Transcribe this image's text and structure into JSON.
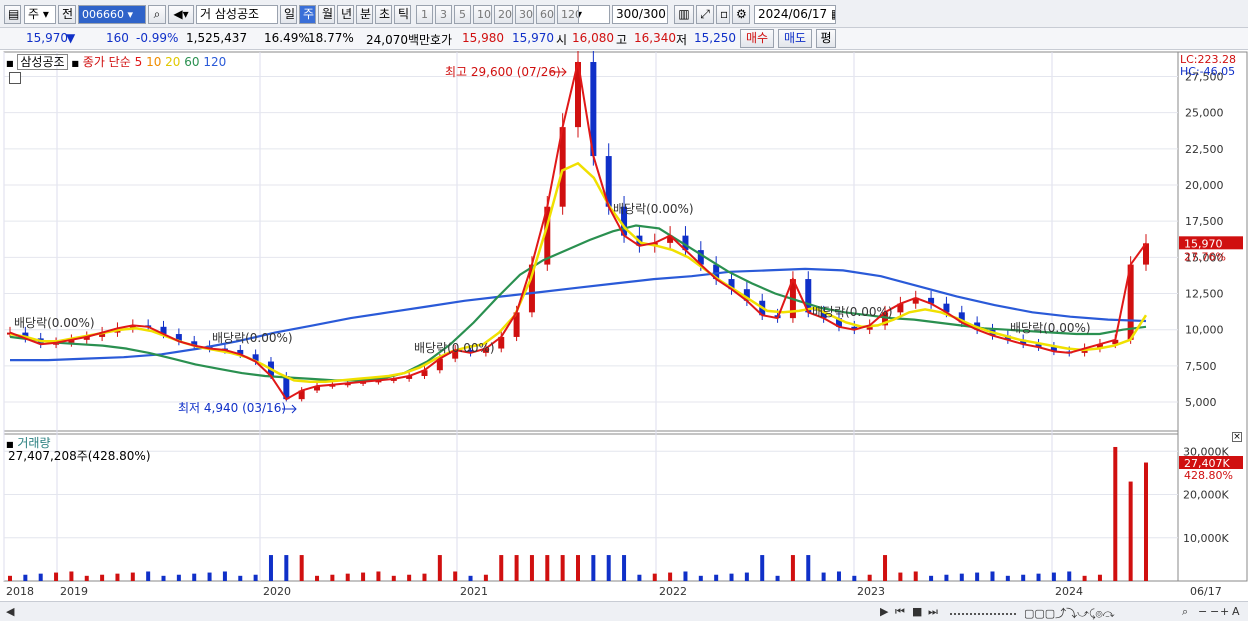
{
  "toolbar": {
    "period_label": "주",
    "prev_label": "전",
    "code": "006660",
    "name_prefix": "거",
    "name": "삼성공조",
    "tabs": [
      "일",
      "주",
      "월",
      "년",
      "분",
      "초",
      "틱"
    ],
    "active_tab": "주",
    "nums": [
      "1",
      "3",
      "5",
      "10",
      "20",
      "30",
      "60",
      "120"
    ],
    "count": "300/300",
    "date": "2024/06/17"
  },
  "quote": {
    "price": "15,970",
    "arrow": "▼",
    "change": "160",
    "rate": "-0.99%",
    "volume": "1,525,437",
    "ratio1": "16.49%",
    "ratio2": "18.77%",
    "amount": "24,070백만",
    "bid_label": "호가",
    "ask": "15,980",
    "bid": "15,970",
    "open_label": "시",
    "open": "16,080",
    "high_label": "고",
    "high": "16,340",
    "low_label": "저",
    "low": "15,250",
    "buy_label": "매수",
    "sell_label": "매도",
    "eval_label": "평"
  },
  "legend": {
    "name": "삼성공조",
    "price_label": "종가 단순",
    "ma": [
      "5",
      "10",
      "20",
      "60",
      "120"
    ],
    "volume_title": "거래량",
    "volume_value": "27,407,208주(428.80%)"
  },
  "colors": {
    "ma5": "#e01818",
    "ma10": "#f08c00",
    "ma20": "#f0e000",
    "ma60": "#2a9050",
    "ma120": "#2a5ad8",
    "up": "#d01010",
    "down": "#1030c8"
  },
  "chart_data": {
    "type": "candlestick",
    "x_labels": [
      "2018",
      "2019",
      "2020",
      "2021",
      "2022",
      "2023",
      "2024",
      "06/17"
    ],
    "y_ticks": [
      "27,500",
      "25,000",
      "22,500",
      "20,000",
      "17,500",
      "15,000",
      "12,500",
      "10,000",
      "7,500",
      "5,000"
    ],
    "y_values": [
      27500,
      25000,
      22500,
      20000,
      17500,
      15000,
      12500,
      10000,
      7500,
      5000
    ],
    "ylim": [
      3000,
      28500
    ],
    "lc": "LC:223.28",
    "hc": "HC:-46.05",
    "current_price": "15,970",
    "current_rate": "27.76%",
    "annotations": [
      {
        "text": "최고 29,600 (07/26)",
        "price": 29600
      },
      {
        "text": "최저 4,940 (03/16)",
        "price": 4940
      },
      {
        "text": "배당락(0.00%)"
      },
      {
        "text": "배당락(0.00%)"
      },
      {
        "text": "배당락(0.00%)"
      },
      {
        "text": "배당락(0.00%)"
      },
      {
        "text": "배당락(0.00%)"
      },
      {
        "text": "배당락(0.00%)"
      }
    ],
    "close_series": [
      9800,
      9400,
      9000,
      9100,
      9300,
      9500,
      9800,
      10100,
      10300,
      10200,
      9700,
      9200,
      8900,
      8700,
      8600,
      8300,
      7800,
      6800,
      5200,
      5800,
      6100,
      6200,
      6300,
      6400,
      6500,
      6600,
      6800,
      7200,
      8000,
      8600,
      8400,
      8700,
      9500,
      11200,
      14500,
      18500,
      24000,
      28500,
      22000,
      18500,
      16500,
      15800,
      16000,
      16500,
      15500,
      14500,
      13500,
      12800,
      12000,
      11000,
      10800,
      13500,
      11200,
      10800,
      10200,
      10000,
      10300,
      11200,
      11800,
      12200,
      11800,
      11200,
      10500,
      10000,
      9600,
      9300,
      9000,
      8800,
      8500,
      8400,
      8700,
      9000,
      9300,
      14500,
      15970
    ],
    "ma_series": {
      "ma20": [
        9700,
        9500,
        9200,
        9200,
        9400,
        9600,
        9800,
        10000,
        10100,
        9900,
        9500,
        9100,
        8800,
        8600,
        8400,
        8100,
        7600,
        7000,
        6500,
        6400,
        6400,
        6500,
        6600,
        6700,
        6800,
        7000,
        7400,
        8000,
        8500,
        8800,
        9000,
        9800,
        11000,
        13500,
        17000,
        21000,
        21500,
        20500,
        18500,
        17000,
        16000,
        15800,
        15500,
        15000,
        14200,
        13400,
        12700,
        12000,
        11300,
        11200,
        11300,
        11500,
        11000,
        10500,
        10200,
        10300,
        10700,
        11200,
        11400,
        11200,
        10800,
        10300,
        9900,
        9600,
        9300,
        9100,
        8900,
        8700,
        8600,
        8700,
        8900,
        9300,
        11000
      ],
      "ma60": [
        9500,
        9300,
        9100,
        9000,
        8900,
        8700,
        8400,
        8000,
        7600,
        7300,
        7000,
        6800,
        6700,
        6600,
        6500,
        6500,
        6600,
        7000,
        7800,
        9000,
        10500,
        12200,
        13800,
        14800,
        15500,
        16200,
        16800,
        17200,
        17000,
        16000,
        15000,
        14000,
        13200,
        12500,
        12000,
        11500,
        11200,
        11000,
        10800,
        10700,
        10500,
        10300,
        10100,
        10000,
        9900,
        9800,
        9700,
        9700,
        10000,
        10200
      ],
      "ma120": [
        7900,
        7900,
        8000,
        8100,
        8300,
        8700,
        9200,
        9800,
        10300,
        10800,
        11200,
        11600,
        12000,
        12300,
        12600,
        12900,
        13200,
        13500,
        13700,
        14000,
        14100,
        14200,
        14100,
        13700,
        13000,
        12300,
        11700,
        11200,
        10900,
        10700,
        10600
      ]
    },
    "volume_ticks": [
      "30,000K",
      "20,000K",
      "10,000K"
    ],
    "volume_last": "27,407K",
    "volume_rate": "428.80%"
  },
  "bottom": {
    "date_label": "06/17"
  }
}
